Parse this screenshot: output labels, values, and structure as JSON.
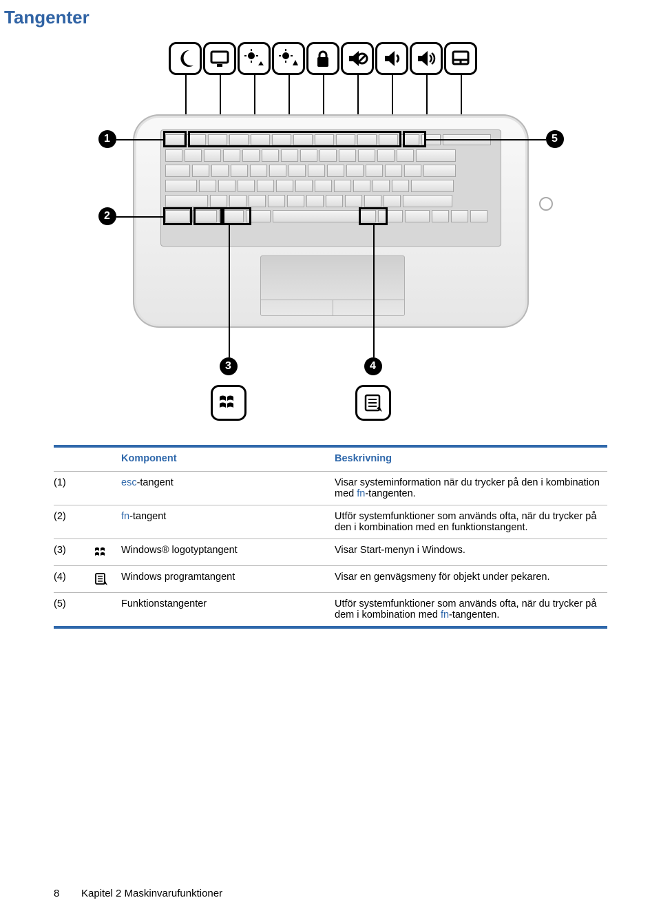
{
  "title": "Tangenter",
  "table": {
    "headers": {
      "component": "Komponent",
      "description": "Beskrivning"
    },
    "rows": [
      {
        "num": "(1)",
        "comp_prefix": "esc",
        "comp_suffix": "-tangent",
        "desc_a": "Visar systeminformation när du trycker på den i kombination med ",
        "desc_fn": "fn",
        "desc_b": "-tangenten."
      },
      {
        "num": "(2)",
        "comp_prefix": "fn",
        "comp_suffix": "-tangent",
        "desc_a": "Utför systemfunktioner som används ofta, när du trycker på den i kombination med en funktionstangent.",
        "desc_fn": "",
        "desc_b": ""
      },
      {
        "num": "(3)",
        "comp_plain": "Windows® logotyptangent",
        "desc_plain": "Visar Start-menyn i Windows."
      },
      {
        "num": "(4)",
        "comp_plain": "Windows programtangent",
        "desc_plain": "Visar en genvägsmeny för objekt under pekaren."
      },
      {
        "num": "(5)",
        "comp_plain": "Funktionstangenter",
        "desc_a": "Utför systemfunktioner som används ofta, när du trycker på dem i kombination med ",
        "desc_fn": "fn",
        "desc_b": "-tangenten."
      }
    ]
  },
  "callouts": {
    "c1": "1",
    "c2": "2",
    "c3": "3",
    "c4": "4",
    "c5": "5"
  },
  "footer": {
    "page": "8",
    "chapter": "Kapitel 2   Maskinvarufunktioner"
  }
}
